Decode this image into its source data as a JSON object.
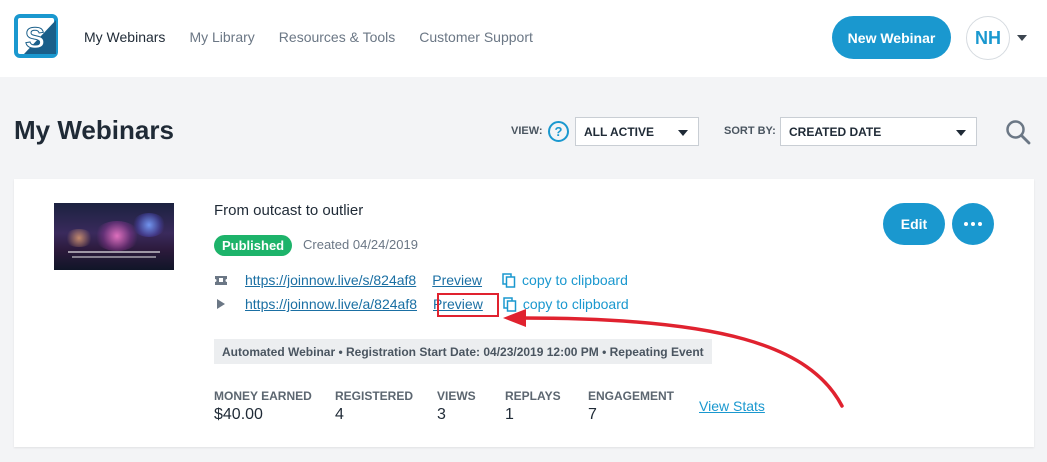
{
  "nav": {
    "items": [
      {
        "label": "My Webinars",
        "active": true
      },
      {
        "label": "My Library",
        "active": false
      },
      {
        "label": "Resources & Tools",
        "active": false
      },
      {
        "label": "Customer Support",
        "active": false
      }
    ],
    "new_webinar_label": "New Webinar",
    "avatar_initials": "NH"
  },
  "header": {
    "title": "My Webinars",
    "view_label": "VIEW:",
    "help_glyph": "?",
    "view_value": "ALL ACTIVE",
    "sort_label": "SORT BY:",
    "sort_value": "CREATED DATE"
  },
  "webinar": {
    "title": "From outcast to outlier",
    "status": "Published",
    "created": "Created 04/24/2019",
    "links": [
      {
        "icon": "ticket-icon",
        "url": "https://joinnow.live/s/824af8",
        "preview": "Preview",
        "copy": "copy to clipboard"
      },
      {
        "icon": "play-icon",
        "url": "https://joinnow.live/a/824af8",
        "preview": "Preview",
        "copy": "copy to clipboard"
      }
    ],
    "info": "Automated Webinar • Registration Start Date: 04/23/2019 12:00 PM • Repeating Event",
    "stats": [
      {
        "label": "MONEY EARNED",
        "value": "$40.00"
      },
      {
        "label": "REGISTERED",
        "value": "4"
      },
      {
        "label": "VIEWS",
        "value": "3"
      },
      {
        "label": "REPLAYS",
        "value": "1"
      },
      {
        "label": "ENGAGEMENT",
        "value": "7"
      }
    ],
    "view_stats_label": "View Stats",
    "edit_label": "Edit"
  },
  "colors": {
    "brand": "#1a98cf",
    "published": "#1db36a",
    "annotation": "#e0222f"
  }
}
